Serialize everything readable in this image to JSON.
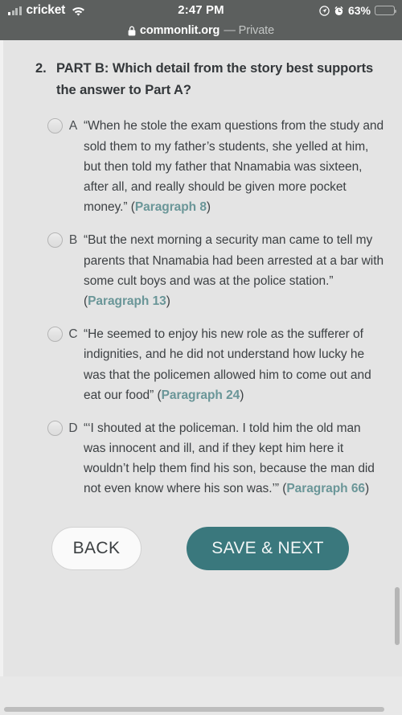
{
  "status_bar": {
    "carrier": "cricket",
    "signal_icon": "signal-bars-icon",
    "wifi_icon": "wifi-icon",
    "time": "2:47 PM",
    "location_icon": "location-arrow-icon",
    "alarm_icon": "alarm-clock-icon",
    "battery_percent": "63%",
    "battery_icon": "battery-icon",
    "battery_fill_color": "#ffd426",
    "battery_level": 63,
    "background_color": "#5c5f5e"
  },
  "url_bar": {
    "lock_icon": "lock-icon",
    "host": "commonlit.org",
    "mode": "— Private"
  },
  "question": {
    "number": "2.",
    "text": "PART B: Which detail from the story best supports the answer to Part A?"
  },
  "options": [
    {
      "letter": "A",
      "radio_icon": "radio-button-unselected-icon",
      "selected": false,
      "quote": "“When he stole the exam questions from the study and sold them to my father’s students, she yelled at him, but then told my father that Nnamabia was sixteen, after all, and really should be given more pocket money.” (",
      "citation": "Paragraph 8",
      "citation_close": ")"
    },
    {
      "letter": "B",
      "radio_icon": "radio-button-unselected-icon",
      "selected": false,
      "quote": "“But the next morning a security man came to tell my parents that Nnamabia had been arrested at a bar with some cult boys and was at the police station.” (",
      "citation": "Paragraph 13",
      "citation_close": ")"
    },
    {
      "letter": "C",
      "radio_icon": "radio-button-unselected-icon",
      "selected": false,
      "quote": "“He seemed to enjoy his new role as the sufferer of indignities, and he did not understand how lucky he was that the policemen allowed him to come out and eat our food” (",
      "citation": "Paragraph 24",
      "citation_close": ")"
    },
    {
      "letter": "D",
      "radio_icon": "radio-button-unselected-icon",
      "selected": false,
      "quote": "“‘I shouted at the policeman. I told him the old man was innocent and ill, and if they kept him here it wouldn’t help them find his son, because the man did not even know where his son was.’” (",
      "citation": "Paragraph 66",
      "citation_close": ")"
    }
  ],
  "footer": {
    "back_label": "BACK",
    "next_label": "SAVE & NEXT",
    "next_color": "#3a787d",
    "link_color": "#6a9698"
  }
}
